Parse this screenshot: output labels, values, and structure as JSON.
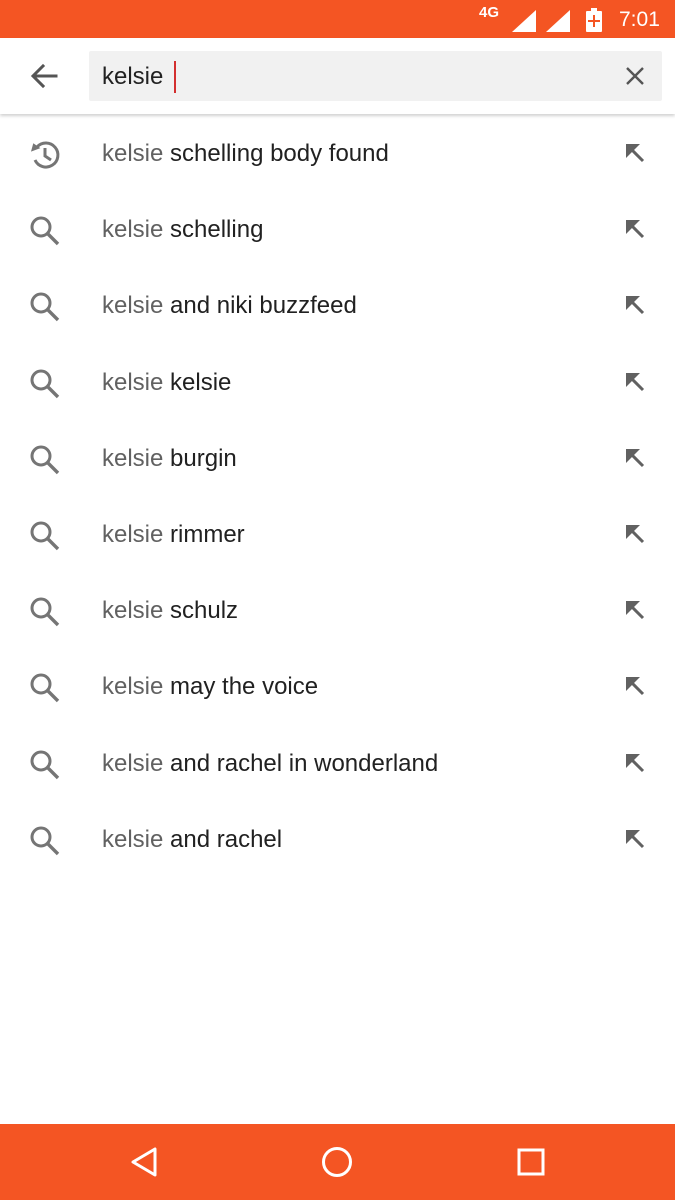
{
  "status_bar": {
    "network": "4G",
    "time": "7:01",
    "color": "#f45523"
  },
  "search": {
    "value": "kelsie",
    "back_icon": "arrow-left-icon",
    "clear_icon": "close-icon"
  },
  "suggestions": [
    {
      "icon": "history-icon",
      "query": "kelsie",
      "completion": " schelling body found"
    },
    {
      "icon": "search-icon",
      "query": "kelsie",
      "completion": " schelling"
    },
    {
      "icon": "search-icon",
      "query": "kelsie",
      "completion": " and niki buzzfeed"
    },
    {
      "icon": "search-icon",
      "query": "kelsie",
      "completion": " kelsie"
    },
    {
      "icon": "search-icon",
      "query": "kelsie",
      "completion": " burgin"
    },
    {
      "icon": "search-icon",
      "query": "kelsie",
      "completion": " rimmer"
    },
    {
      "icon": "search-icon",
      "query": "kelsie",
      "completion": " schulz"
    },
    {
      "icon": "search-icon",
      "query": "kelsie",
      "completion": " may the voice"
    },
    {
      "icon": "search-icon",
      "query": "kelsie",
      "completion": " and rachel in wonderland"
    },
    {
      "icon": "search-icon",
      "query": "kelsie",
      "completion": " and rachel"
    }
  ],
  "nav_bar": {
    "buttons": [
      "back-triangle-icon",
      "home-circle-icon",
      "recents-square-icon"
    ],
    "color": "#f45523"
  }
}
